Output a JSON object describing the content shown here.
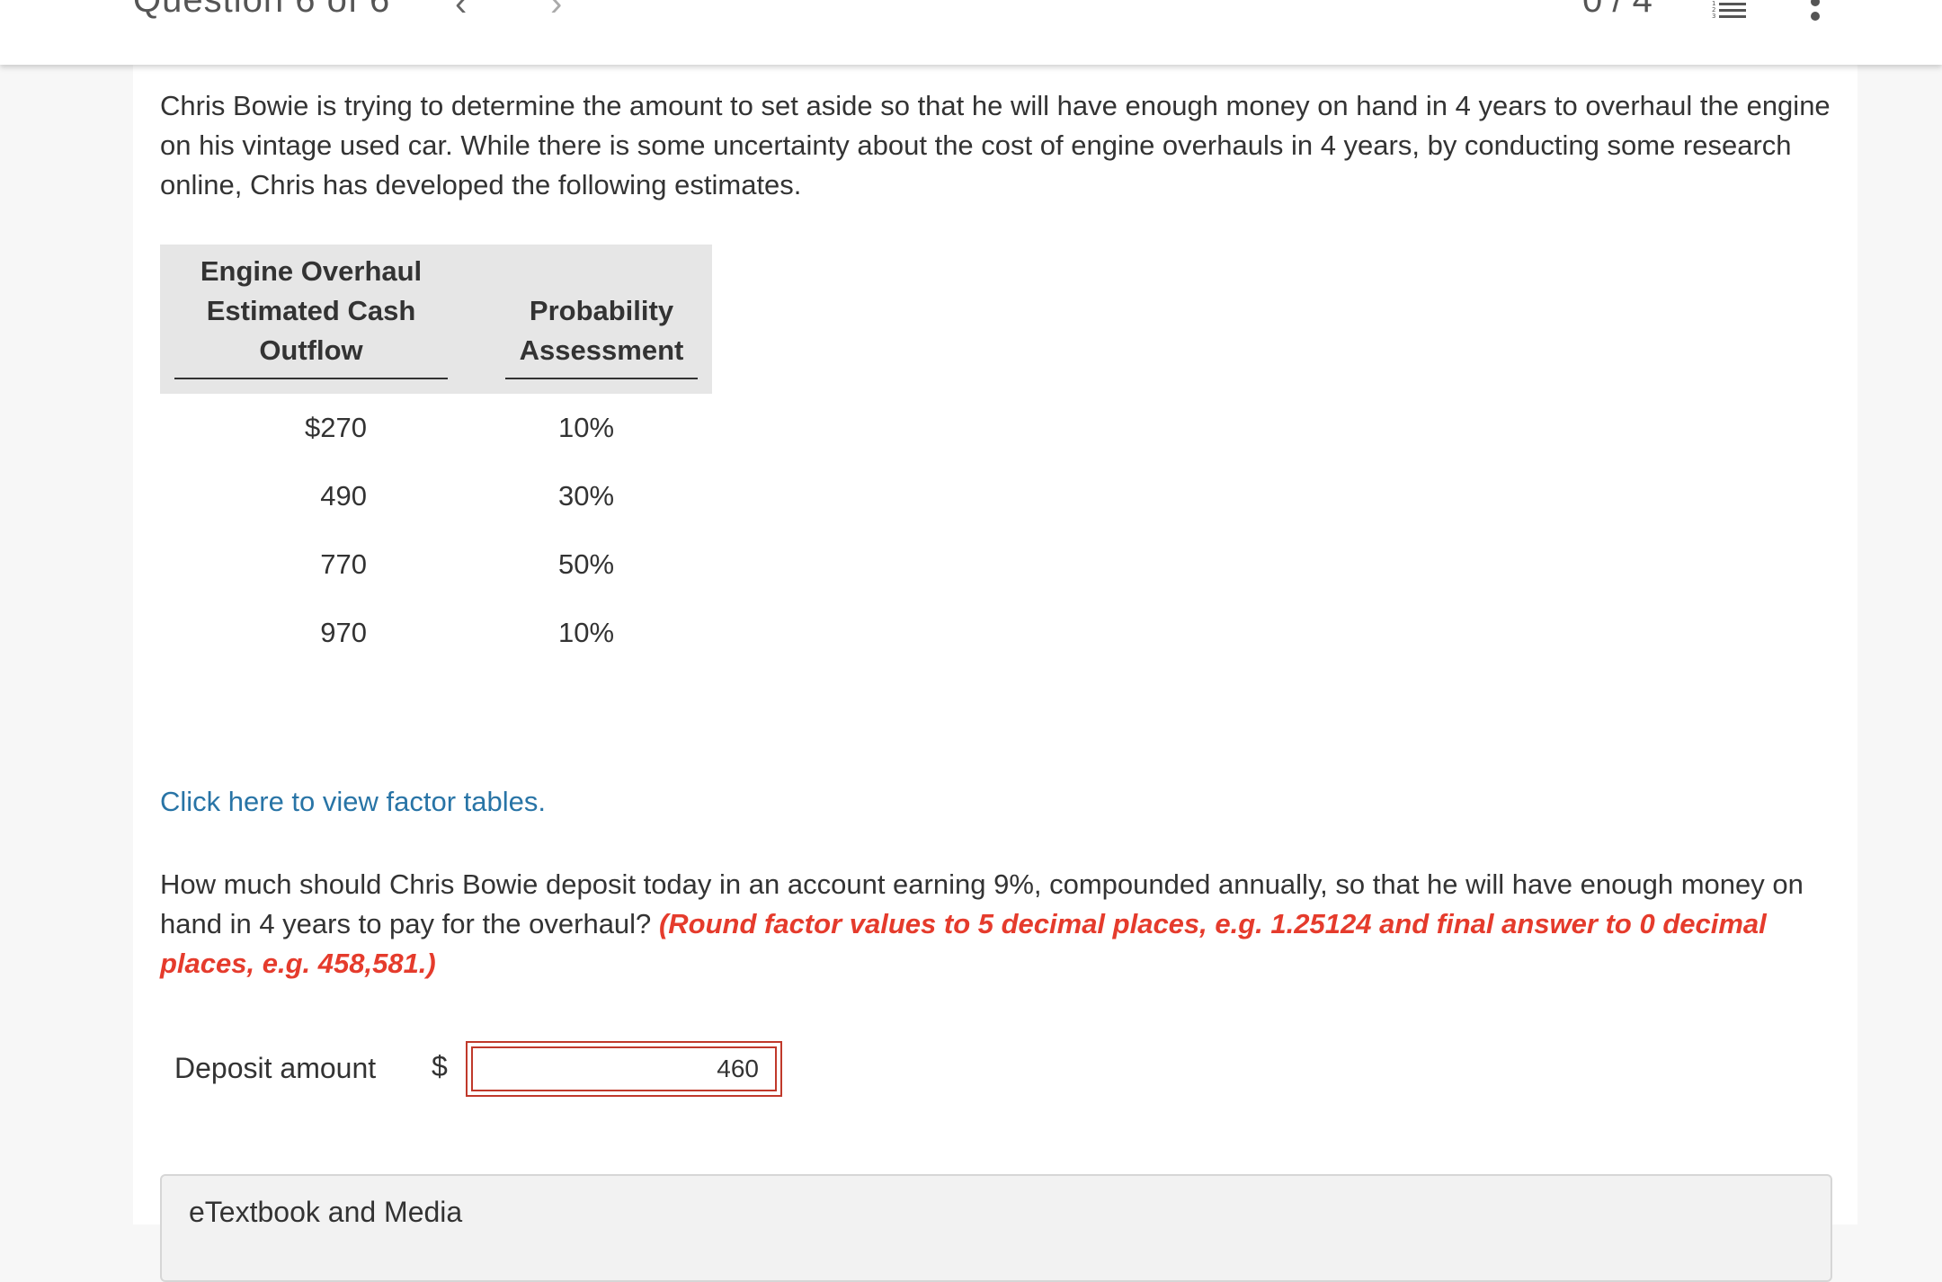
{
  "header": {
    "question_title": "Question 6 of 6",
    "score": "0 / 4"
  },
  "problem": {
    "intro": "Chris Bowie is trying to determine the amount to set aside so that he will have enough money on hand in 4 years to overhaul the engine on his vintage used car. While there is some uncertainty about the cost of engine overhauls in 4 years, by conducting some research online, Chris has developed the following estimates.",
    "table": {
      "col1_header": "Engine Overhaul Estimated Cash Outflow",
      "col2_header": "Probability Assessment",
      "rows": [
        {
          "amount": "$270",
          "probability": "10%"
        },
        {
          "amount": "490",
          "probability": "30%"
        },
        {
          "amount": "770",
          "probability": "50%"
        },
        {
          "amount": "970",
          "probability": "10%"
        }
      ]
    },
    "factor_link": "Click here to view factor tables.",
    "question": "How much should Chris Bowie deposit today in an account earning 9%, compounded annually, so that he will have enough money on hand in 4 years to pay for the overhaul?",
    "rounding_hint": "(Round factor values to 5 decimal places, e.g. 1.25124 and final answer to 0 decimal places, e.g. 458,581.)"
  },
  "answer": {
    "label": "Deposit amount",
    "currency": "$",
    "value": "460"
  },
  "etextbook": {
    "label": "eTextbook and Media"
  },
  "colors": {
    "hint_red": "#e53b2c",
    "link_blue": "#2874a6",
    "error_border": "#c0392b"
  }
}
